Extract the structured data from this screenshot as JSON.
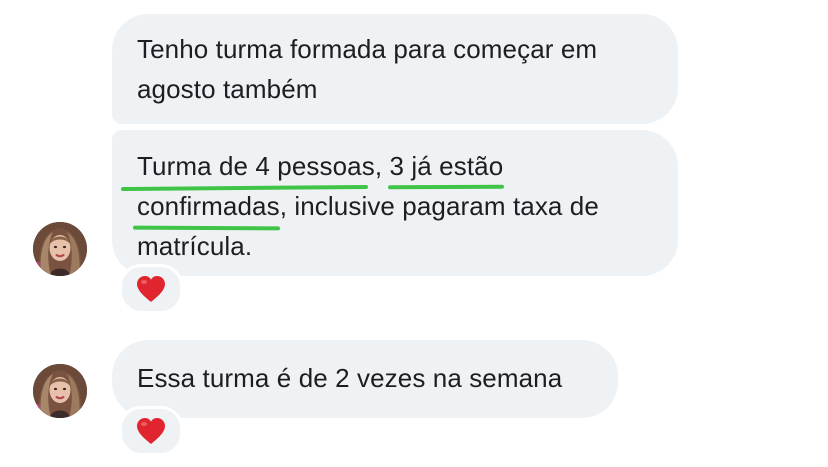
{
  "conversation": {
    "messages": [
      {
        "lines": [
          "Tenho turma formada para começar em",
          "agosto também"
        ]
      },
      {
        "line1_a": "Turma de 4 pessoas",
        "line1_b": ",",
        "line1_c": "3 já estão",
        "line2_a": "confirmadas",
        "line2_b": ", inclusive pagaram taxa de",
        "line3": "matrícula.",
        "reaction": "❤️"
      },
      {
        "lines": [
          "Essa turma é de 2 vezes na semana"
        ],
        "reaction": "❤️"
      }
    ]
  },
  "colors": {
    "bubble_background": "#eff2f5",
    "text": "#1c1e21",
    "highlight_underline": "#3fc447",
    "heart": "#e1252f"
  },
  "icons": {
    "avatar": "contact-profile-photo",
    "reaction": "red-heart-icon"
  }
}
